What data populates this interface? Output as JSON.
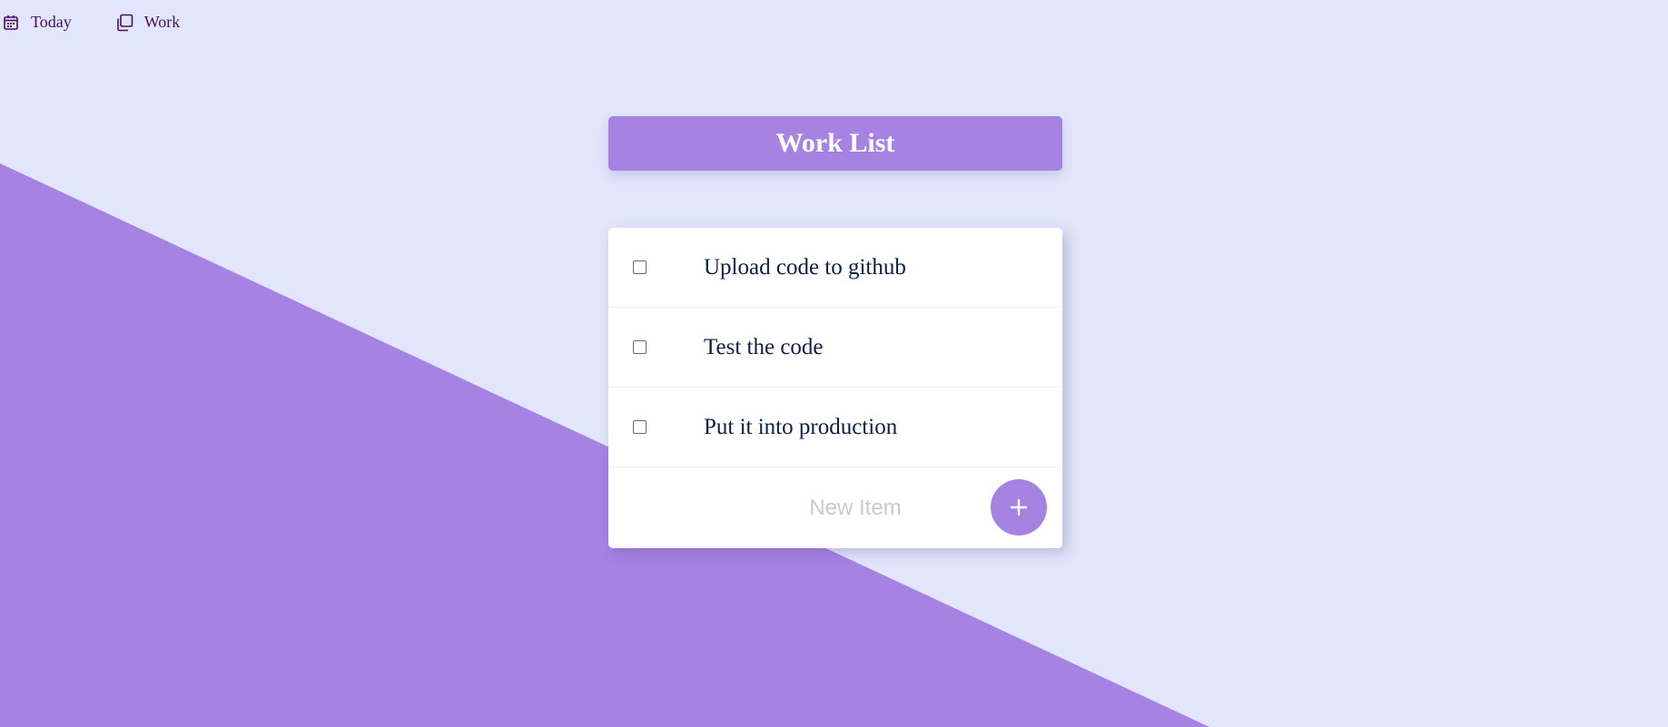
{
  "nav": {
    "today": {
      "label": "Today",
      "icon": "calendar-icon"
    },
    "work": {
      "label": "Work",
      "icon": "copy-icon"
    }
  },
  "list": {
    "title": "Work List",
    "items": [
      {
        "label": "Upload code to github",
        "checked": false
      },
      {
        "label": "Test the code",
        "checked": false
      },
      {
        "label": "Put it into production",
        "checked": false
      }
    ],
    "new_item": {
      "placeholder": "New Item",
      "value": ""
    },
    "add_button": {
      "icon": "plus-icon"
    }
  },
  "colors": {
    "background": "#e2e6fb",
    "accent": "#a683e3",
    "nav_text": "#4a0a6a",
    "item_text": "#0c1f46"
  }
}
